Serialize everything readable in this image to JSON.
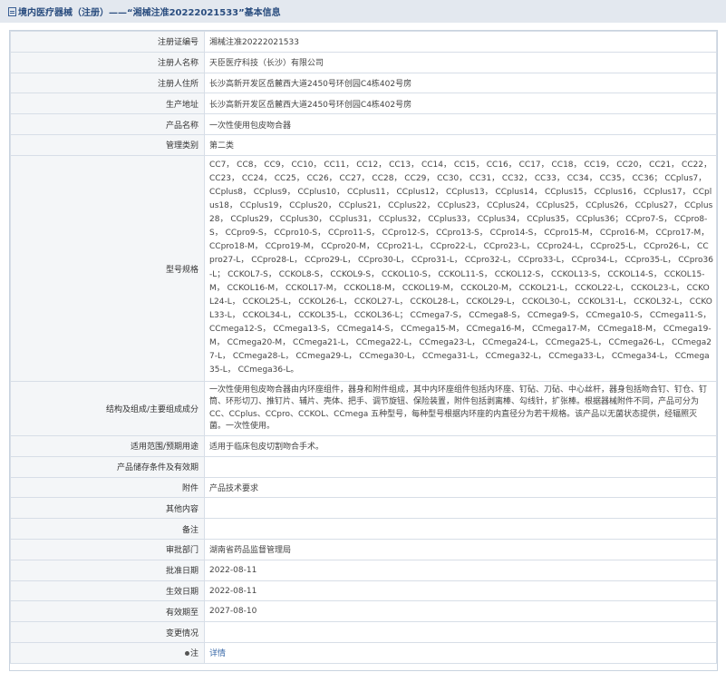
{
  "header": {
    "title": "境内医疗器械（注册）——“湘械注准20222021533”基本信息"
  },
  "rows": [
    {
      "label": "注册证编号",
      "value": "湘械注准20222021533"
    },
    {
      "label": "注册人名称",
      "value": "天臣医疗科技（长沙）有限公司"
    },
    {
      "label": "注册人住所",
      "value": "长沙高新开发区岳麓西大道2450号环创园C4栋402号房"
    },
    {
      "label": "生产地址",
      "value": "长沙高新开发区岳麓西大道2450号环创园C4栋402号房"
    },
    {
      "label": "产品名称",
      "value": "一次性使用包皮吻合器"
    },
    {
      "label": "管理类别",
      "value": "第二类"
    },
    {
      "label": "型号规格",
      "value": "CC7， CC8， CC9， CC10， CC11， CC12， CC13， CC14， CC15， CC16， CC17， CC18， CC19， CC20， CC21， CC22， CC23， CC24， CC25， CC26， CC27， CC28， CC29， CC30， CC31， CC32， CC33， CC34， CC35， CC36； CCplus7， CCplus8， CCplus9， CCplus10， CCplus11， CCplus12， CCplus13， CCplus14， CCplus15， CCplus16， CCplus17， CCplus18， CCplus19， CCplus20， CCplus21， CCplus22， CCplus23， CCplus24， CCplus25， CCplus26， CCplus27， CCplus28， CCplus29， CCplus30， CCplus31， CCplus32， CCplus33， CCplus34， CCplus35， CCplus36； CCpro7-S， CCpro8-S， CCpro9-S， CCpro10-S， CCpro11-S， CCpro12-S， CCpro13-S， CCpro14-S， CCpro15-M， CCpro16-M， CCpro17-M， CCpro18-M， CCpro19-M， CCpro20-M， CCpro21-L， CCpro22-L， CCpro23-L， CCpro24-L， CCpro25-L， CCpro26-L， CCpro27-L， CCpro28-L， CCpro29-L， CCpro30-L， CCpro31-L， CCpro32-L， CCpro33-L， CCpro34-L， CCpro35-L， CCpro36-L； CCKOL7-S， CCKOL8-S， CCKOL9-S， CCKOL10-S， CCKOL11-S， CCKOL12-S， CCKOL13-S， CCKOL14-S， CCKOL15-M， CCKOL16-M， CCKOL17-M， CCKOL18-M， CCKOL19-M， CCKOL20-M， CCKOL21-L， CCKOL22-L， CCKOL23-L， CCKOL24-L， CCKOL25-L， CCKOL26-L， CCKOL27-L， CCKOL28-L， CCKOL29-L， CCKOL30-L， CCKOL31-L， CCKOL32-L， CCKOL33-L， CCKOL34-L， CCKOL35-L， CCKOL36-L； CCmega7-S， CCmega8-S， CCmega9-S， CCmega10-S， CCmega11-S， CCmega12-S， CCmega13-S， CCmega14-S， CCmega15-M， CCmega16-M， CCmega17-M， CCmega18-M， CCmega19-M， CCmega20-M， CCmega21-L， CCmega22-L， CCmega23-L， CCmega24-L， CCmega25-L， CCmega26-L， CCmega27-L， CCmega28-L， CCmega29-L， CCmega30-L， CCmega31-L， CCmega32-L， CCmega33-L， CCmega34-L， CCmega35-L， CCmega36-L。"
    },
    {
      "label": "结构及组成/主要组成成分",
      "value": "一次性使用包皮吻合器由内环座组件，器身和附件组成，其中内环座组件包括内环座、钉砧、刀砧、中心丝杆，器身包括吻合钉、钉仓、钉筒、环形切刀、推钉片、辅片、壳体、把手、调节旋钮、保险装置，附件包括剥离棒、勾线针，扩张棒。根据器械附件不同，产品可分为CC、CCplus、CCpro、CCKOL、CCmega 五种型号，每种型号根据内环座的内直径分为若干规格。该产品以无菌状态提供，经辐照灭菌。一次性使用。"
    },
    {
      "label": "适用范围/预期用途",
      "value": "适用于临床包皮切割吻合手术。"
    },
    {
      "label": "产品储存条件及有效期",
      "value": ""
    },
    {
      "label": "附件",
      "value": "产品技术要求"
    },
    {
      "label": "其他内容",
      "value": ""
    },
    {
      "label": "备注",
      "value": ""
    },
    {
      "label": "审批部门",
      "value": "湖南省药品监督管理局"
    },
    {
      "label": "批准日期",
      "value": "2022-08-11"
    },
    {
      "label": "生效日期",
      "value": "2022-08-11"
    },
    {
      "label": "有效期至",
      "value": "2027-08-10"
    },
    {
      "label": "变更情况",
      "value": ""
    },
    {
      "label": "注",
      "value": "详情"
    }
  ]
}
